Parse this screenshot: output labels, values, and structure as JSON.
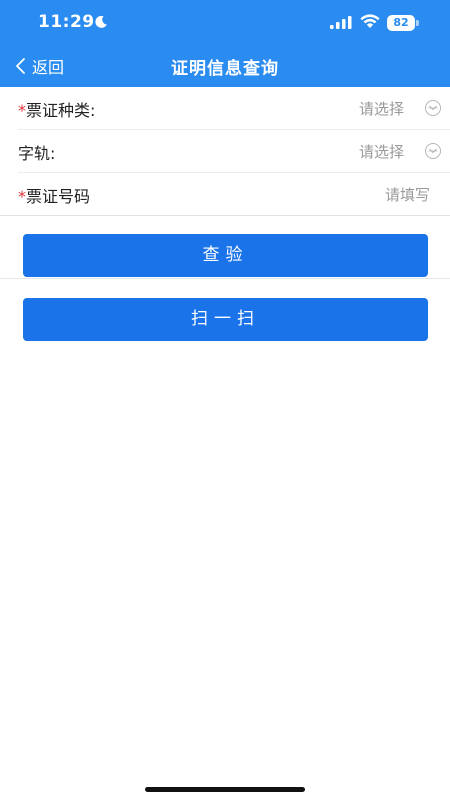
{
  "status_bar": {
    "time": "11:29",
    "battery_level": "82"
  },
  "nav": {
    "back_label": "返回",
    "title": "证明信息查询"
  },
  "form": {
    "fields": [
      {
        "required_mark": "*",
        "label": "票证种类:",
        "value": "请选择",
        "kind": "select"
      },
      {
        "required_mark": "",
        "label": "字轨:",
        "value": "请选择",
        "kind": "select"
      },
      {
        "required_mark": "*",
        "label": "票证号码",
        "value": "请填写",
        "kind": "input"
      }
    ]
  },
  "buttons": {
    "verify_label": "查验",
    "scan_label": "扫一扫"
  },
  "colors": {
    "header_bg": "#2a8cf0",
    "button_bg": "#1a73e8",
    "required": "#e0353b",
    "placeholder": "#9a9a9a"
  }
}
